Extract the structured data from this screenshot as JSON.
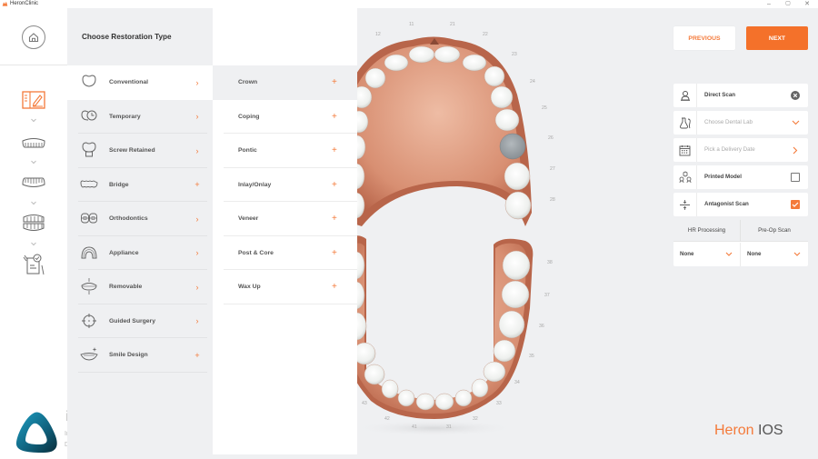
{
  "window": {
    "title": "HeronClinic",
    "controls": {
      "minimize": "–",
      "maximize": "▢",
      "close": "✕"
    }
  },
  "rail": {
    "home_icon": "home-icon",
    "steps": [
      {
        "name": "prescription",
        "icon": "prescription-form-icon",
        "active": true
      },
      {
        "name": "upper-jaw",
        "icon": "upper-jaw-icon",
        "active": false
      },
      {
        "name": "lower-jaw",
        "icon": "lower-jaw-icon",
        "active": false
      },
      {
        "name": "bite",
        "icon": "bite-icon",
        "active": false
      },
      {
        "name": "review",
        "icon": "review-checklist-icon",
        "active": false
      }
    ]
  },
  "categories": {
    "header": "Choose Restoration Type",
    "items": [
      {
        "label": "Conventional",
        "icon": "crown-icon",
        "action": "›",
        "active": true
      },
      {
        "label": "Temporary",
        "icon": "temporary-clock-icon",
        "action": "›",
        "active": false
      },
      {
        "label": "Screw Retained",
        "icon": "screw-retained-icon",
        "action": "›",
        "active": false
      },
      {
        "label": "Bridge",
        "icon": "bridge-icon",
        "action": "+",
        "active": false
      },
      {
        "label": "Orthodontics",
        "icon": "orthodontics-icon",
        "action": "›",
        "active": false
      },
      {
        "label": "Appliance",
        "icon": "appliance-icon",
        "action": "›",
        "active": false
      },
      {
        "label": "Removable",
        "icon": "removable-icon",
        "action": "›",
        "active": false
      },
      {
        "label": "Guided Surgery",
        "icon": "guided-surgery-icon",
        "action": "›",
        "active": false
      },
      {
        "label": "Smile Design",
        "icon": "smile-design-icon",
        "action": "+",
        "active": false
      }
    ]
  },
  "subtypes": {
    "items": [
      {
        "label": "Crown",
        "active": true
      },
      {
        "label": "Coping",
        "active": false
      },
      {
        "label": "Pontic",
        "active": false
      },
      {
        "label": "Inlay/Onlay",
        "active": false
      },
      {
        "label": "Veneer",
        "active": false
      },
      {
        "label": "Post & Core",
        "active": false
      },
      {
        "label": "Wax Up",
        "active": false
      }
    ],
    "action": "+"
  },
  "tooth_chart": {
    "upper_numbers": [
      "11",
      "12",
      "21",
      "22",
      "23",
      "24",
      "25",
      "26",
      "27",
      "28"
    ],
    "lower_numbers": [
      "38",
      "37",
      "36",
      "35",
      "34",
      "33",
      "32",
      "31",
      "41",
      "42",
      "43"
    ],
    "selected_tooth": "26",
    "selected_color": "#9aa1a6"
  },
  "nav": {
    "previous": "PREVIOUS",
    "next": "NEXT"
  },
  "options": {
    "scan_type": {
      "label": "Direct Scan",
      "icon": "user-scan-icon",
      "action": "clear-icon"
    },
    "dental_lab": {
      "placeholder": "Choose Dental Lab",
      "icon": "dental-lab-icon",
      "action": "chevron-down-icon"
    },
    "delivery_date": {
      "placeholder": "Pick a Delivery Date",
      "icon": "calendar-icon",
      "action": "chevron-right-icon"
    },
    "printed_model": {
      "label": "Printed Model",
      "icon": "printed-model-icon",
      "checked": false
    },
    "antagonist_scan": {
      "label": "Antagonist Scan",
      "icon": "antagonist-icon",
      "checked": true
    }
  },
  "processing": {
    "hr_label": "HR Processing",
    "hr_value": "None",
    "preop_label": "Pre-Op Scan",
    "preop_value": "None"
  },
  "branding": {
    "idd_title": "iDD",
    "idd_line1": "Institute of",
    "idd_line2": "Digital Dentistry",
    "product_part1": "Heron",
    "product_part2": "IOS"
  },
  "colors": {
    "accent": "#f47a3a",
    "next_button": "#f4712a",
    "background": "#eff0f2"
  }
}
